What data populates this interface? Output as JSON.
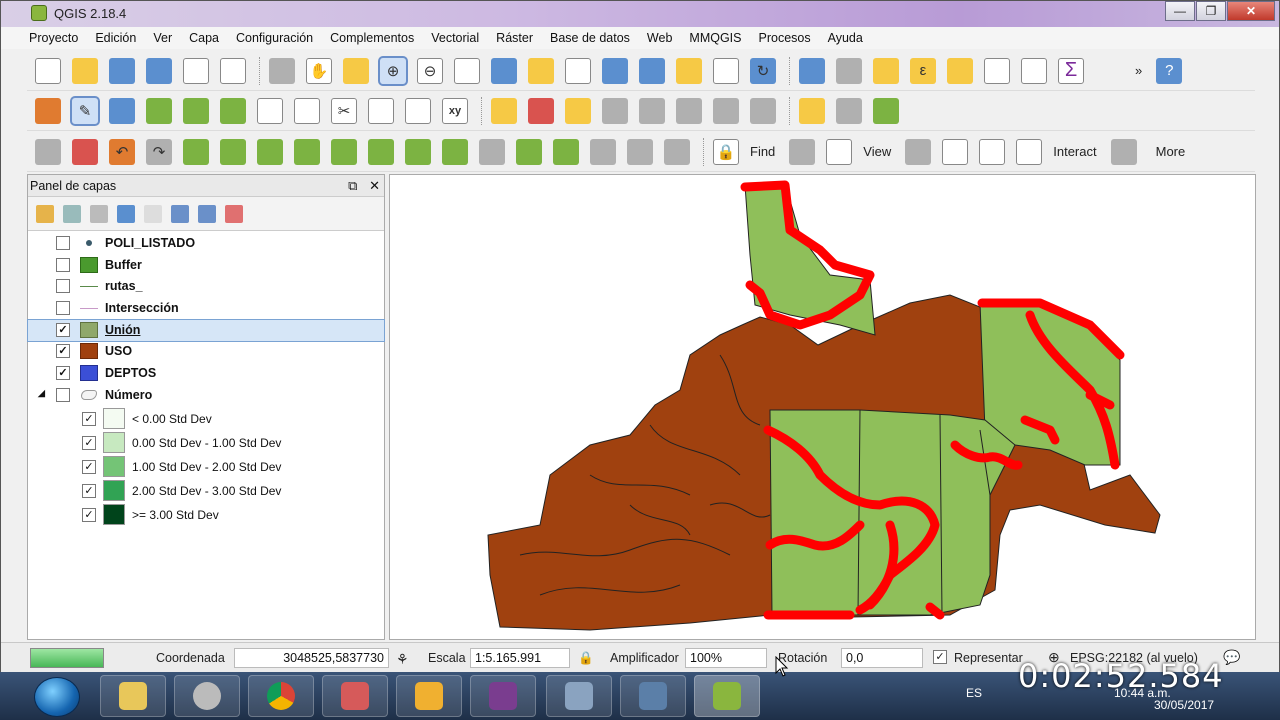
{
  "window": {
    "title": "QGIS 2.18.4",
    "min": "—",
    "max": "❐",
    "close": "✕"
  },
  "menu": [
    "Proyecto",
    "Edición",
    "Ver",
    "Capa",
    "Configuración",
    "Complementos",
    "Vectorial",
    "Ráster",
    "Base de datos",
    "Web",
    "MMQGIS",
    "Procesos",
    "Ayuda"
  ],
  "toolbar3": {
    "find": "Find",
    "view": "View",
    "interact": "Interact",
    "more": "More",
    "overflow": "»",
    "help": "?"
  },
  "panel": {
    "title": "Panel de capas",
    "float": "⧉",
    "close": "✕",
    "layers": [
      {
        "name": "POLI_LISTADO",
        "checked": false,
        "symbol": "point",
        "color": "#3a5a6a"
      },
      {
        "name": "Buffer",
        "checked": false,
        "symbol": "fill",
        "color": "#4a9a2e"
      },
      {
        "name": "rutas_",
        "checked": false,
        "symbol": "line",
        "color": "#5a8a4a"
      },
      {
        "name": "Intersección",
        "checked": false,
        "symbol": "line",
        "color": "#c89ac8"
      },
      {
        "name": "Unión",
        "checked": true,
        "symbol": "fill",
        "color": "#8fa86a",
        "selected": true
      },
      {
        "name": "USO",
        "checked": true,
        "symbol": "fill",
        "color": "#a0410f"
      },
      {
        "name": "DEPTOS",
        "checked": true,
        "symbol": "fill",
        "color": "#3b4fd6"
      },
      {
        "name": "Número",
        "checked": false,
        "symbol": "group",
        "color": "#cccccc"
      }
    ],
    "classes": [
      {
        "label": "< 0.00 Std Dev",
        "color": "#f4fbf2"
      },
      {
        "label": "0.00 Std Dev - 1.00 Std Dev",
        "color": "#c7e9c0"
      },
      {
        "label": "1.00 Std Dev - 2.00 Std Dev",
        "color": "#74c476"
      },
      {
        "label": "2.00 Std Dev - 3.00 Std Dev",
        "color": "#31a354"
      },
      {
        "label": ">= 3.00 Std Dev",
        "color": "#00441b"
      }
    ]
  },
  "status": {
    "coord_label": "Coordenada",
    "coord_value": "3048525,5837730",
    "scale_label": "Escala",
    "scale_value": "1:5.165.991",
    "magnifier_label": "Amplificador",
    "magnifier_value": "100%",
    "rotation_label": "Rotación",
    "rotation_value": "0,0",
    "render_label": "Representar",
    "render_checked": true,
    "crs": "EPSG:22182 (al vuelo)"
  },
  "taskbar": {
    "lang": "ES",
    "time": "10:44 a.m.",
    "date": "30/05/2017"
  },
  "overlay": {
    "timer": "0:02:52.584"
  },
  "colors": {
    "uso": "#a0410f",
    "union": "#8fbf5a",
    "buffer_red": "#ff0000"
  }
}
